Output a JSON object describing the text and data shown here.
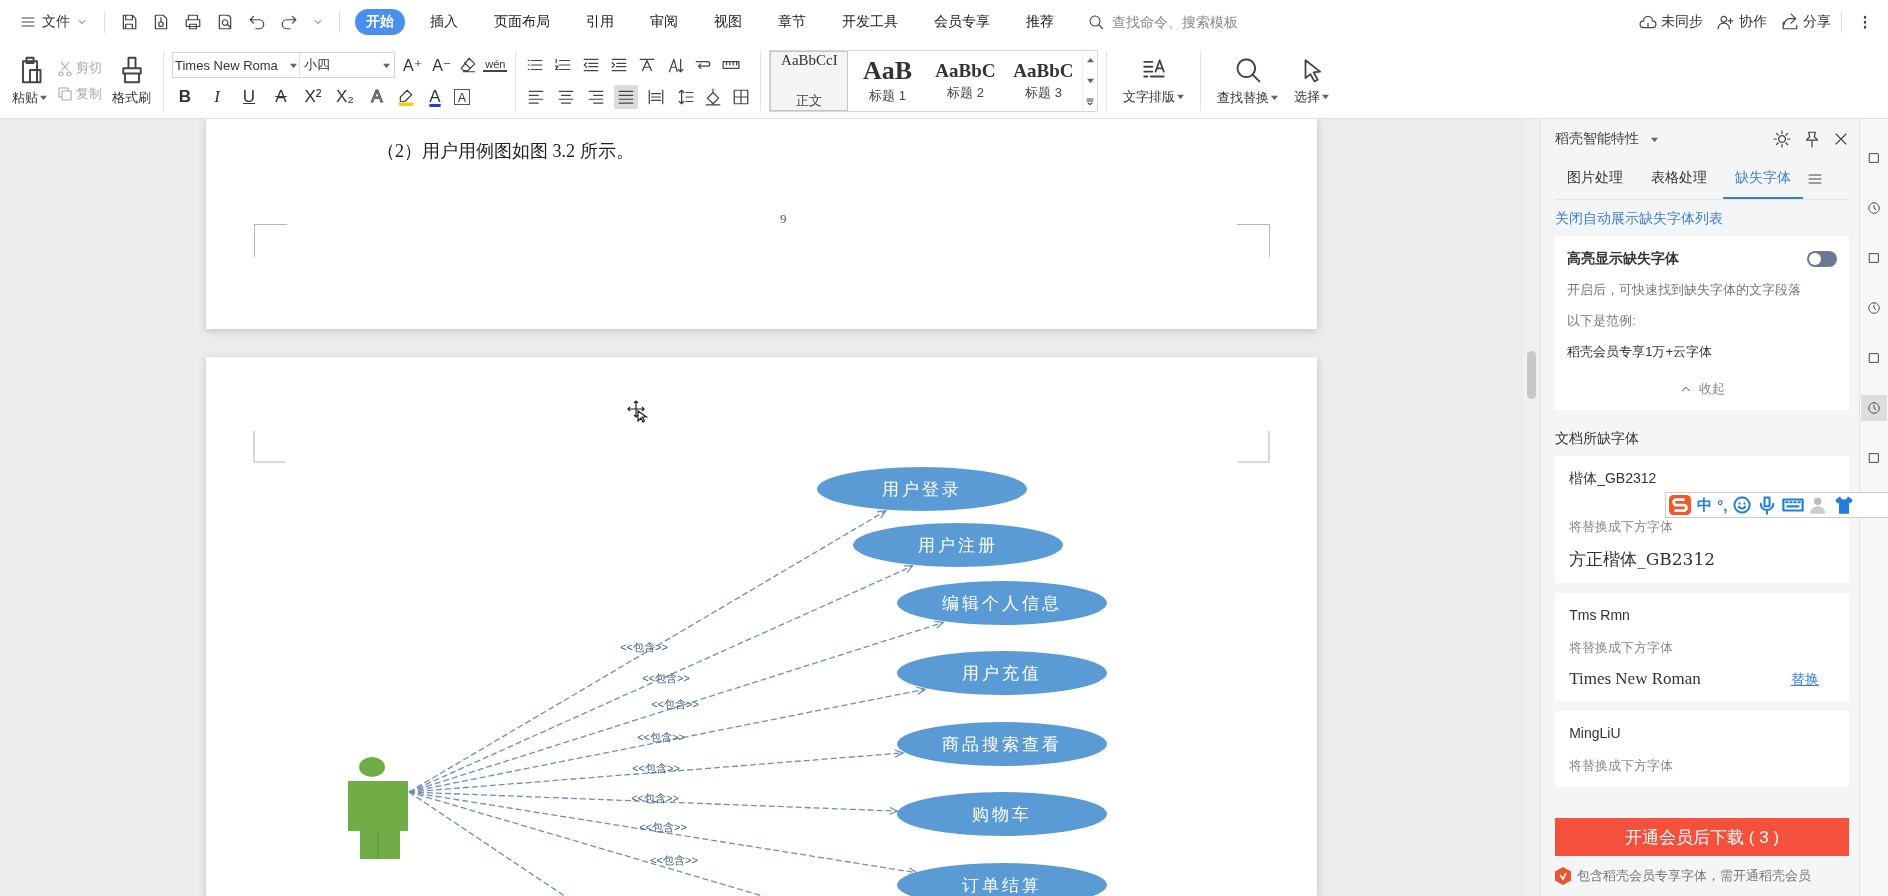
{
  "menu_bar": {
    "file_menu": "文件",
    "tabs": [
      {
        "label": "开始",
        "selected": true
      },
      {
        "label": "插入",
        "selected": false
      },
      {
        "label": "页面布局",
        "selected": false
      },
      {
        "label": "引用",
        "selected": false
      },
      {
        "label": "审阅",
        "selected": false
      },
      {
        "label": "视图",
        "selected": false
      },
      {
        "label": "章节",
        "selected": false
      },
      {
        "label": "开发工具",
        "selected": false
      },
      {
        "label": "会员专享",
        "selected": false
      },
      {
        "label": "推荐",
        "selected": false
      }
    ],
    "search": {
      "placeholder": "查找命令、搜索模板"
    },
    "actions": [
      "未同步",
      "协作",
      "分享"
    ]
  },
  "ribbon": {
    "paste": "粘贴",
    "edit_buttons": [
      {
        "label": "剪切",
        "kind": "cut",
        "disabled": true
      },
      {
        "label": "复制",
        "kind": "copy",
        "disabled": true
      }
    ],
    "format_painter": "格式刷",
    "font_name": "Times New Roma",
    "font_size": "小四",
    "size_glyphs": [
      "A⁺",
      "A⁻"
    ],
    "phonetic_glyph": "wén",
    "format_glyphs": [
      {
        "glyph": "B",
        "kind": "bold"
      },
      {
        "glyph": "I",
        "kind": "italic"
      },
      {
        "glyph": "U",
        "kind": "underline"
      },
      {
        "glyph": "A",
        "kind": "strike"
      },
      {
        "glyph": "X²",
        "kind": "plain"
      },
      {
        "glyph": "X₂",
        "kind": "plain"
      },
      {
        "glyph": "A",
        "kind": "outline"
      },
      {
        "glyph": "A",
        "kind": "color"
      },
      {
        "glyph": "A",
        "kind": "boxed"
      }
    ],
    "alignment": [
      {
        "kind": "left",
        "selected": false
      },
      {
        "kind": "center",
        "selected": false
      },
      {
        "kind": "right",
        "selected": false
      },
      {
        "kind": "justify",
        "selected": true
      },
      {
        "kind": "distributed",
        "selected": false
      }
    ],
    "styles": [
      {
        "preview": "AaBbCcI",
        "label": "正文",
        "kind": "body",
        "selected": true
      },
      {
        "preview": "AaB",
        "label": "标题 1",
        "kind": "heading1",
        "selected": false
      },
      {
        "preview": "AaBbC",
        "label": "标题 2",
        "kind": "heading2",
        "selected": false
      },
      {
        "preview": "AaBbC",
        "label": "标题 3",
        "kind": "heading3",
        "selected": false
      }
    ],
    "text_layout": "文字排版",
    "find_replace": "查找替换",
    "select": "选择"
  },
  "document": {
    "page_1": {
      "paragraph": "（2）用户用例图如图 3.2 所示。",
      "page_number": "9"
    },
    "page_2": {
      "diagram": {
        "use_cases": [
          "用户登录",
          "用户注册",
          "编辑个人信息",
          "用户充值",
          "商品搜索查看",
          "购物车",
          "订单结算"
        ],
        "include_labels": [
          "<<包含>>",
          "<<包含>>",
          "<<包含>>",
          "<<包含>>",
          "<<包含>>",
          "<<包含>>",
          "<<包含>>",
          "<<包含>>"
        ]
      }
    }
  },
  "side_panel": {
    "title": "稻壳智能特性",
    "tabs": [
      {
        "label": "图片处理",
        "selected": false
      },
      {
        "label": "表格处理",
        "selected": false
      },
      {
        "label": "缺失字体",
        "selected": true
      }
    ],
    "close_auto_link": "关闭自动展示缺失字体列表",
    "highlight_card": {
      "title": "高亮显示缺失字体",
      "on": false,
      "description": "开启后，可快速找到缺失字体的文字段落",
      "example_label": "以下是范例:",
      "example": "稻壳会员专享1万+云字体",
      "collapse": "收起"
    },
    "missing_heading": "文档所缺字体",
    "missing_fonts": [
      {
        "name": "楷体_GB2312",
        "note": "将替换成下方字体",
        "replacement": "方正楷体_GB2312"
      },
      {
        "name": "Tms Rmn",
        "note": "将替换成下方字体",
        "replacement": "Times New Roman",
        "action": "替换"
      },
      {
        "name": "MingLiU",
        "note": "将替换成下方字体"
      }
    ],
    "download_button": "开通会员后下载 ( 3 )",
    "footer_note": "包含稻壳会员专享字体，需开通稻壳会员"
  },
  "ime_toolbar": {
    "mode": "中",
    "punctuation": "°,"
  }
}
